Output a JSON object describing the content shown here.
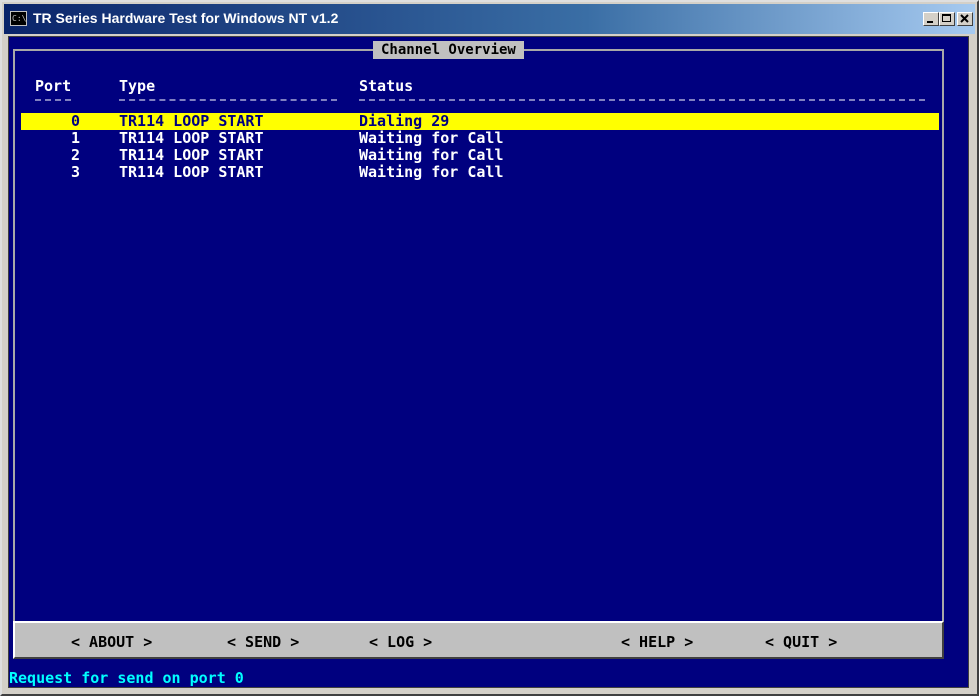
{
  "window": {
    "title": "TR Series Hardware Test for Windows NT v1.2",
    "icon": "C:\\",
    "controls": [
      "minimize",
      "maximize",
      "close"
    ]
  },
  "panel": {
    "title": "Channel Overview"
  },
  "table": {
    "headers": {
      "port": "Port",
      "type": "Type",
      "status": "Status"
    },
    "rows": [
      {
        "port": "0",
        "type": "TR114 LOOP START",
        "status": "Dialing 29",
        "selected": true
      },
      {
        "port": "1",
        "type": "TR114 LOOP START",
        "status": "Waiting for Call"
      },
      {
        "port": "2",
        "type": "TR114 LOOP START",
        "status": "Waiting for Call"
      },
      {
        "port": "3",
        "type": "TR114 LOOP START",
        "status": "Waiting for Call"
      }
    ]
  },
  "menu": {
    "about": "< ABOUT >",
    "send": "< SEND >",
    "log": "< LOG >",
    "help": "< HELP >",
    "quit": "< QUIT >"
  },
  "status_line": "Request for send on port 0",
  "colors": {
    "console_bg": "#00007f",
    "highlight_bg": "#ffff00",
    "highlight_fg": "#000080",
    "status_fg": "#00ffff"
  }
}
